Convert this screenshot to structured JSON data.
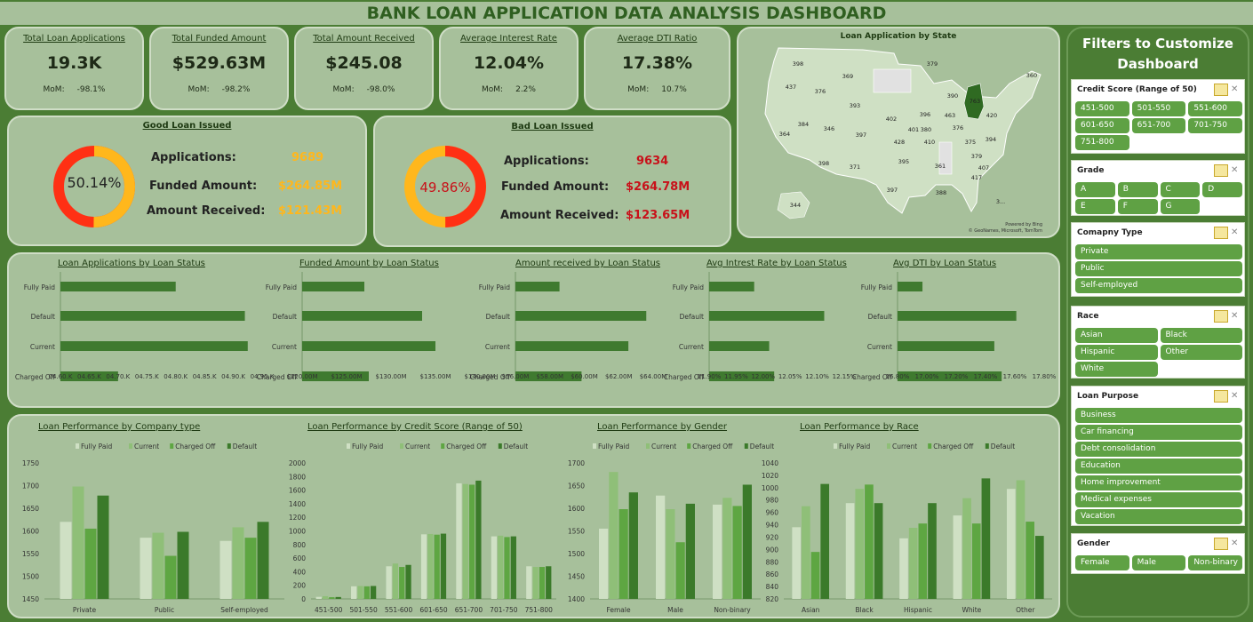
{
  "title": "BANK LOAN APPLICATION DATA ANALYSIS DASHBOARD",
  "kpis": [
    {
      "label": "Total Loan Applications",
      "value": "19.3K",
      "mom_label": "MoM:",
      "mom": "-98.1%"
    },
    {
      "label": "Total Funded Amount",
      "value": "$529.63M",
      "mom_label": "MoM:",
      "mom": "-98.2%"
    },
    {
      "label": "Total Amount Received",
      "value": "$245.08",
      "mom_label": "MoM:",
      "mom": "-98.0%"
    },
    {
      "label": "Average Interest Rate",
      "value": "12.04%",
      "mom_label": "MoM:",
      "mom": "2.2%"
    },
    {
      "label": "Average DTI Ratio",
      "value": "17.38%",
      "mom_label": "MoM:",
      "mom": "10.7%"
    }
  ],
  "good": {
    "title": "Good Loan Issued",
    "pct": "50.14%",
    "fraction": 0.5014,
    "rows": [
      {
        "label": "Applications:",
        "value": "9689"
      },
      {
        "label": "Funded Amount:",
        "value": "$264.85M"
      },
      {
        "label": "Amount Received:",
        "value": "$121.43M"
      }
    ]
  },
  "bad": {
    "title": "Bad Loan Issued",
    "pct": "49.86%",
    "fraction": 0.4986,
    "rows": [
      {
        "label": "Applications:",
        "value": "9634"
      },
      {
        "label": "Funded Amount:",
        "value": "$264.78M"
      },
      {
        "label": "Amount Received:",
        "value": "$123.65M"
      }
    ]
  },
  "map": {
    "title": "Loan Application by State",
    "credit": "Powered by Bing",
    "credit2": "© GeoNames, Microsoft, TomTom",
    "labels": [
      "360",
      "398",
      "369",
      "379",
      "437",
      "390",
      "376",
      "763",
      "393",
      "402",
      "396",
      "463",
      "420",
      "384",
      "346",
      "401",
      "380",
      "364",
      "397",
      "428",
      "410",
      "376",
      "375",
      "394",
      "395",
      "361",
      "379",
      "371",
      "398",
      "407",
      "417",
      "397",
      "388",
      "344",
      "3..."
    ]
  },
  "colors": {
    "bg": "#4b7d34",
    "panel": "#a7c09b",
    "good_main": "#ffb71c",
    "good_minor": "#ff3014",
    "bad_main": "#ff3014",
    "bad_minor": "#ffb71c",
    "bar": "#3f7a2f",
    "fully_paid": "#cfe0c4",
    "current": "#8fbf78",
    "charged_off": "#5ea642",
    "default": "#3b7a2a"
  },
  "chart_data": [
    {
      "type": "bar",
      "orientation": "horizontal",
      "title": "Loan Applications by Loan Status",
      "categories": [
        "Fully Paid",
        "Default",
        "Current",
        "Charged Off"
      ],
      "values": [
        4.8,
        4.92,
        4.925,
        4.7
      ],
      "xlim": [
        4.6,
        4.95
      ],
      "xticks": [
        "04.60.K",
        "04.65.K",
        "04.70.K",
        "04.75.K",
        "04.80.K",
        "04.85.K",
        "04.90.K",
        "04.95.K"
      ]
    },
    {
      "type": "bar",
      "orientation": "horizontal",
      "title": "Funded Amount by Loan Status",
      "categories": [
        "Fully Paid",
        "Default",
        "Current",
        "Charged Off"
      ],
      "values": [
        127,
        133.5,
        135,
        127.5
      ],
      "xlim": [
        120,
        140
      ],
      "xticks": [
        "$120.00M",
        "$125.00M",
        "$130.00M",
        "$135.00M",
        "$140.00M"
      ]
    },
    {
      "type": "bar",
      "orientation": "horizontal",
      "title": "Amount received by Loan Status",
      "categories": [
        "Fully Paid",
        "Default",
        "Current",
        "Charged Off"
      ],
      "values": [
        59.2,
        65.5,
        64.2,
        60.8
      ],
      "xlim": [
        56,
        66
      ],
      "xticks": [
        "$56.00M",
        "$58.00M",
        "$60.00M",
        "$62.00M",
        "$64.00M"
      ]
    },
    {
      "type": "bar",
      "orientation": "horizontal",
      "title": "Avg Intrest Rate by Loan Status",
      "categories": [
        "Fully Paid",
        "Default",
        "Current",
        "Charged Off"
      ],
      "values": [
        11.99,
        12.13,
        12.02,
        12.03
      ],
      "xlim": [
        11.9,
        12.17
      ],
      "xticks": [
        "11.90%",
        "11.95%",
        "12.00%",
        "12.05%",
        "12.10%",
        "12.15%"
      ]
    },
    {
      "type": "bar",
      "orientation": "horizontal",
      "title": "Avg DTI by Loan Status",
      "categories": [
        "Fully Paid",
        "Default",
        "Current",
        "Charged Off"
      ],
      "values": [
        16.97,
        17.61,
        17.46,
        17.51
      ],
      "xlim": [
        16.8,
        17.8
      ],
      "xticks": [
        "16.80%",
        "17.00%",
        "17.20%",
        "17.40%",
        "17.60%",
        "17.80%"
      ]
    },
    {
      "type": "bar",
      "title": "Loan Performance by Company type",
      "legend": [
        "Fully Paid",
        "Current",
        "Charged Off",
        "Default"
      ],
      "categories": [
        "Private",
        "Public",
        "Self-employed"
      ],
      "series": [
        {
          "name": "Fully Paid",
          "values": [
            1620,
            1585,
            1578
          ]
        },
        {
          "name": "Current",
          "values": [
            1698,
            1596,
            1608
          ]
        },
        {
          "name": "Charged Off",
          "values": [
            1605,
            1545,
            1585
          ]
        },
        {
          "name": "Default",
          "values": [
            1678,
            1598,
            1620
          ]
        }
      ],
      "ylim": [
        1450,
        1750
      ],
      "yticks": [
        1450,
        1500,
        1550,
        1600,
        1650,
        1700,
        1750
      ]
    },
    {
      "type": "bar",
      "title": "Loan Performance by Credit Score (Range of 50)",
      "legend": [
        "Fully Paid",
        "Current",
        "Charged Off",
        "Default"
      ],
      "categories": [
        "451-500",
        "501-550",
        "551-600",
        "601-650",
        "651-700",
        "701-750",
        "751-800"
      ],
      "series": [
        {
          "name": "Fully Paid",
          "values": [
            30,
            185,
            480,
            950,
            1700,
            920,
            480
          ]
        },
        {
          "name": "Current",
          "values": [
            40,
            190,
            520,
            955,
            1690,
            930,
            470
          ]
        },
        {
          "name": "Charged Off",
          "values": [
            25,
            185,
            470,
            945,
            1680,
            910,
            470
          ]
        },
        {
          "name": "Default",
          "values": [
            28,
            190,
            500,
            960,
            1740,
            920,
            480
          ]
        }
      ],
      "ylim": [
        0,
        2000
      ],
      "yticks": [
        0,
        200,
        400,
        600,
        800,
        1000,
        1200,
        1400,
        1600,
        1800,
        2000
      ]
    },
    {
      "type": "bar",
      "title": "Loan Performance by Gender",
      "legend": [
        "Fully Paid",
        "Current",
        "Charged Off",
        "Default"
      ],
      "categories": [
        "Female",
        "Male",
        "Non-binary"
      ],
      "series": [
        {
          "name": "Fully Paid",
          "values": [
            1555,
            1628,
            1608
          ]
        },
        {
          "name": "Current",
          "values": [
            1680,
            1598,
            1623
          ]
        },
        {
          "name": "Charged Off",
          "values": [
            1598,
            1525,
            1605
          ]
        },
        {
          "name": "Default",
          "values": [
            1635,
            1610,
            1652
          ]
        }
      ],
      "ylim": [
        1400,
        1700
      ],
      "yticks": [
        1400,
        1450,
        1500,
        1550,
        1600,
        1650,
        1700
      ]
    },
    {
      "type": "bar",
      "title": "Loan Performance by Race",
      "legend": [
        "Fully Paid",
        "Current",
        "Charged Off",
        "Default"
      ],
      "categories": [
        "Asian",
        "Black",
        "Hispanic",
        "White",
        "Other"
      ],
      "series": [
        {
          "name": "Fully Paid",
          "values": [
            936,
            975,
            918,
            955,
            998
          ]
        },
        {
          "name": "Current",
          "values": [
            970,
            998,
            935,
            983,
            1012
          ]
        },
        {
          "name": "Charged Off",
          "values": [
            896,
            1005,
            942,
            942,
            945
          ]
        },
        {
          "name": "Default",
          "values": [
            1006,
            975,
            975,
            1015,
            922
          ]
        }
      ],
      "ylim": [
        820,
        1040
      ],
      "yticks": [
        820,
        840,
        860,
        880,
        900,
        920,
        940,
        960,
        980,
        1000,
        1020,
        1040
      ]
    }
  ],
  "filters": {
    "title": "Filters to Customize Dashboard",
    "slicers": [
      {
        "name": "Credit Score (Range of 50)",
        "items": [
          "451-500",
          "501-550",
          "551-600",
          "601-650",
          "651-700",
          "701-750",
          "751-800"
        ]
      },
      {
        "name": "Grade",
        "items": [
          "A",
          "B",
          "C",
          "D",
          "E",
          "F",
          "G"
        ]
      },
      {
        "name": "Comapny Type",
        "items": [
          "Private",
          "Public",
          "Self-employed"
        ]
      },
      {
        "name": "Race",
        "items": [
          "Asian",
          "Black",
          "Hispanic",
          "Other",
          "White"
        ]
      },
      {
        "name": "Loan Purpose",
        "items": [
          "Business",
          "Car financing",
          "Debt consolidation",
          "Education",
          "Home improvement",
          "Medical expenses",
          "Vacation"
        ]
      },
      {
        "name": "Gender",
        "items": [
          "Female",
          "Male",
          "Non-binary"
        ]
      }
    ]
  }
}
